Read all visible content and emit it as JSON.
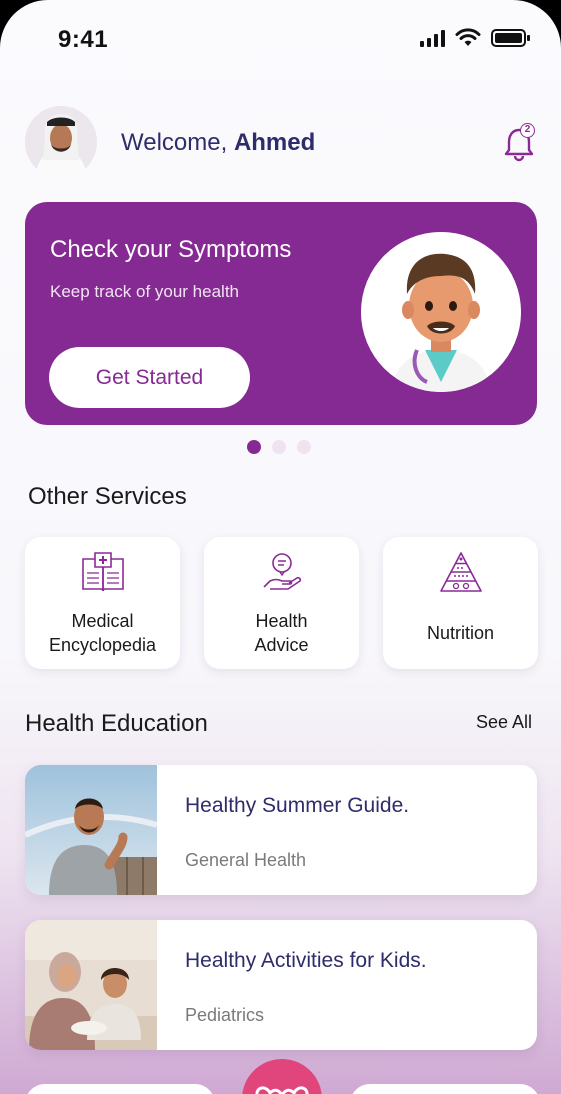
{
  "status_bar": {
    "time": "9:41"
  },
  "header": {
    "greeting": "Welcome,",
    "user_name": "Ahmed",
    "notification_count": "2"
  },
  "banner": {
    "title": "Check your Symptoms",
    "subtitle": "Keep track of your health",
    "cta_label": "Get Started",
    "page_count": 3,
    "active_page": 1
  },
  "services_section": {
    "title": "Other Services",
    "items": [
      {
        "label": "Medical\nEncyclopedia",
        "icon": "book-medical-icon"
      },
      {
        "label": "Health\nAdvice",
        "icon": "hand-heart-chat-icon"
      },
      {
        "label": "Nutrition",
        "icon": "food-pyramid-icon"
      }
    ]
  },
  "education_section": {
    "title": "Health Education",
    "see_all_label": "See All",
    "articles": [
      {
        "title": "Healthy Summer Guide.",
        "category": "General Health"
      },
      {
        "title": "Healthy Activities for Kids.",
        "category": "Pediatrics"
      }
    ]
  },
  "colors": {
    "primary": "#862a93",
    "text_dark": "#2f2c6b",
    "accent_pink": "#e0457b"
  }
}
